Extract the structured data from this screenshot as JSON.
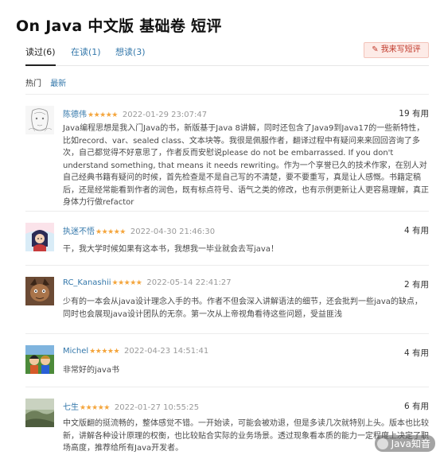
{
  "page": {
    "title": "On Java 中文版 基础卷 短评"
  },
  "tabs": [
    {
      "label": "读过(6)"
    },
    {
      "label": "在读(1)"
    },
    {
      "label": "想读(3)"
    }
  ],
  "write_button": {
    "label": "我来写短评"
  },
  "sort": {
    "hot": "热门",
    "newest": "最新"
  },
  "reviews": [
    {
      "user": "陈德伟",
      "stars": "★★★★★",
      "time": "2022-01-29 23:07:47",
      "useful": "19 有用",
      "content": "Java编程思想是我入门Java的书，新版基于Java 8讲解，同时还包含了Java9到Java17的一些新特性，比如record、var、sealed class、文本块等。我很是佩服作者，翻译过程中有疑问来来回回咨询了多次，自己都觉得不好意思了，作者反而安慰说please do not be embarrassed. If you don't understand something, that means it needs rewriting。作为一个享誉已久的技术作家，在别人对自己经典书籍有疑问的时候，首先检查是不是自己写的不清楚，要不要重写，真是让人感慨。书籍定稿后，还是经常能看到作者的润色，既有标点符号、语气之类的修改，也有示例更新让人更容易理解，真正身体力行做refactor"
    },
    {
      "user": "执迷不悟",
      "stars": "★★★★★",
      "time": "2022-04-30 21:46:30",
      "useful": "4 有用",
      "content": "干，我大学时候如果有这本书，我想我一毕业就会去写java！"
    },
    {
      "user": "RC_Kanashii",
      "stars": "★★★★★",
      "time": "2022-05-14 22:41:27",
      "useful": "2 有用",
      "content": "少有的一本会从java设计理念入手的书。作者不但会深入讲解语法的细节，还会批判一些java的缺点，同时也会展现java设计团队的无奈。第一次从上帝视角看待这些问题，受益匪浅"
    },
    {
      "user": "Michel",
      "stars": "★★★★★",
      "time": "2022-04-23 14:51:41",
      "useful": "4 有用",
      "content": "非常好的java书"
    },
    {
      "user": "七生",
      "stars": "★★★★★",
      "time": "2022-01-27 10:55:25",
      "useful": "6 有用",
      "content": "中文版翻的挺流畅的，整体感觉不错。一开始读，可能会被劝退，但是多读几次就特别上头。版本也比较新，讲解各种设计原理的权衡，也比较贴合实际的业务场景。透过现象看本质的能力一定程度上决定了职场高度，推荐给所有Java开发者。"
    }
  ],
  "watermark": {
    "label": "Java知音"
  }
}
